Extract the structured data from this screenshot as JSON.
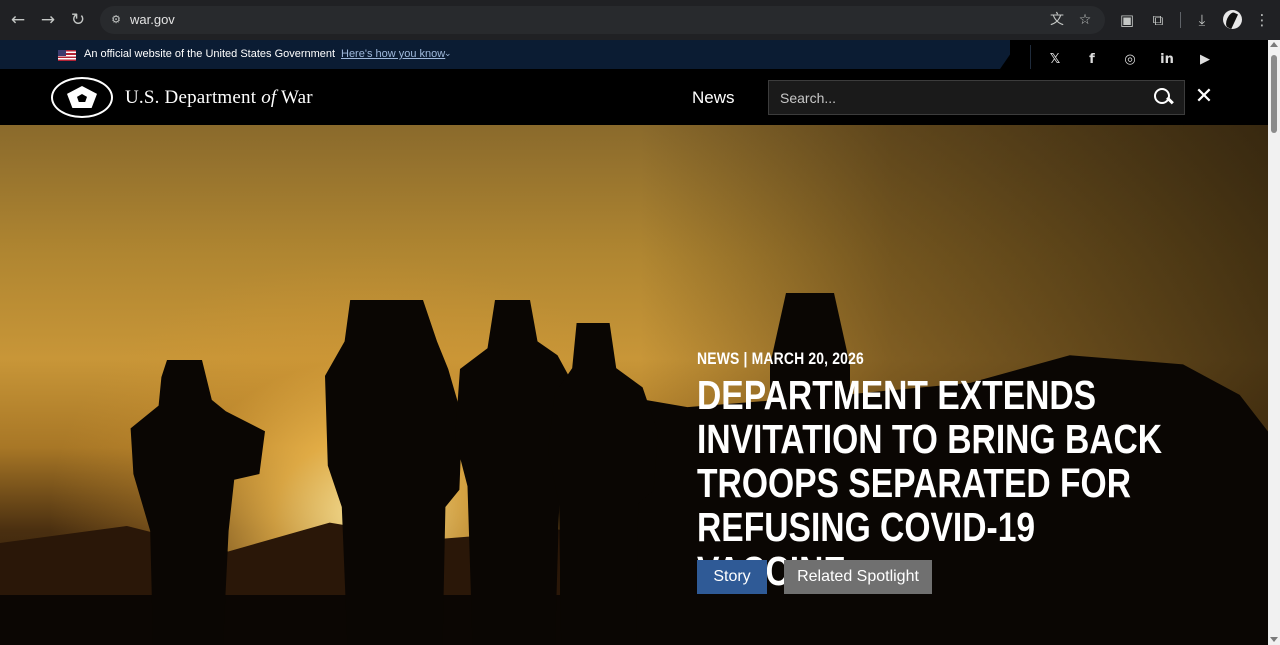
{
  "browser": {
    "url": "war.gov",
    "icons": [
      "back-icon",
      "forward-icon",
      "reload-icon",
      "site-info-icon",
      "translate-icon",
      "bookmark-star-icon",
      "cast-icon",
      "extensions-icon",
      "downloads-icon",
      "profile-avatar",
      "menu-icon"
    ],
    "glyphs": {
      "back": "←",
      "forward": "→",
      "reload": "↻",
      "site_info": "⚙",
      "translate": "文",
      "star": "☆",
      "cast": "▣",
      "extensions": "⧉",
      "downloads": "⤓",
      "menu": "⋮"
    }
  },
  "gov_banner": {
    "official_text": "An official website of the United States Government",
    "how_link": "Here's how you know",
    "caret": "⌄"
  },
  "social": {
    "x": "𝕏",
    "facebook": "f",
    "instagram": "◎",
    "linkedin": "in",
    "youtube": "▶"
  },
  "header": {
    "dept_prefix": "U.S. Department",
    "dept_of": "of",
    "dept_suffix": "War",
    "nav_news": "News",
    "search_placeholder": "Search...",
    "close_glyph": "✕"
  },
  "hero": {
    "meta": "NEWS | MARCH 20, 2026",
    "title": "DEPARTMENT EXTENDS INVITATION TO BRING BACK TROOPS SEPARATED FOR REFUSING COVID-19 VACCINE",
    "buttons": {
      "story": "Story",
      "related": "Related Spotlight"
    }
  },
  "colors": {
    "gov_banner_bg": "#0b1c33",
    "story_button": "#2f5a96",
    "related_button": "#707070"
  }
}
